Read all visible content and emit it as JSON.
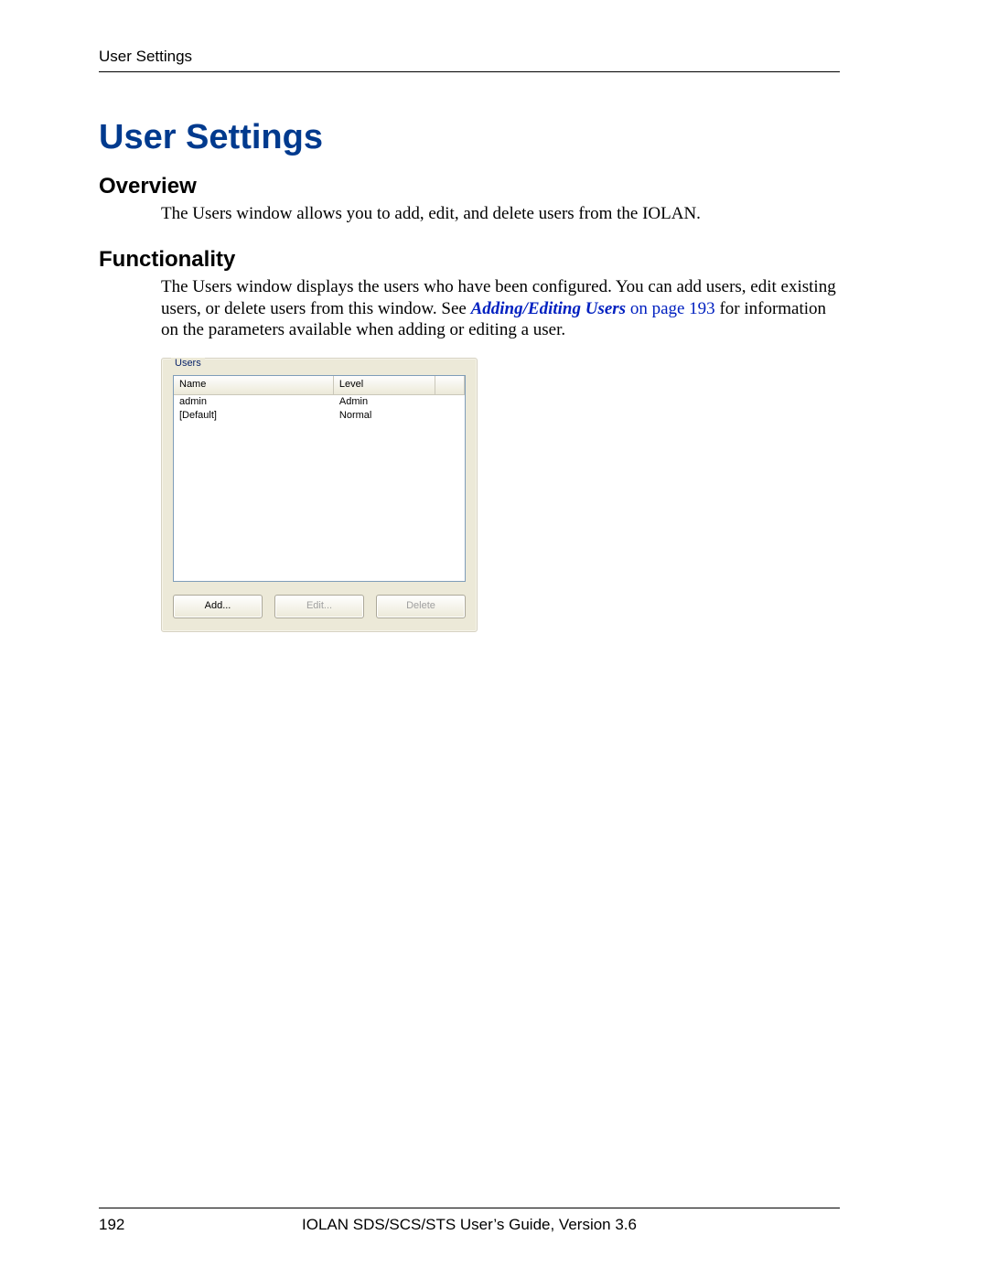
{
  "header": {
    "running": "User Settings"
  },
  "title": "User Settings",
  "sections": {
    "overview": {
      "heading": "Overview",
      "body": "The Users window allows you to add, edit, and delete users from the IOLAN."
    },
    "functionality": {
      "heading": "Functionality",
      "body_pre": "The Users window displays the users who have been configured. You can add users, edit existing users, or delete users from this window. See ",
      "xref_italic": "Adding/Editing Users",
      "xref_plain": " on page 193",
      "body_post": " for information on the parameters available when adding or editing a user."
    }
  },
  "panel": {
    "group_label": "Users",
    "columns": {
      "name": "Name",
      "level": "Level"
    },
    "rows": [
      {
        "name": "admin",
        "level": "Admin"
      },
      {
        "name": "[Default]",
        "level": "Normal"
      }
    ],
    "buttons": {
      "add": "Add...",
      "edit": "Edit...",
      "delete": "Delete"
    }
  },
  "footer": {
    "page_number": "192",
    "guide": "IOLAN SDS/SCS/STS User’s Guide, Version 3.6"
  }
}
